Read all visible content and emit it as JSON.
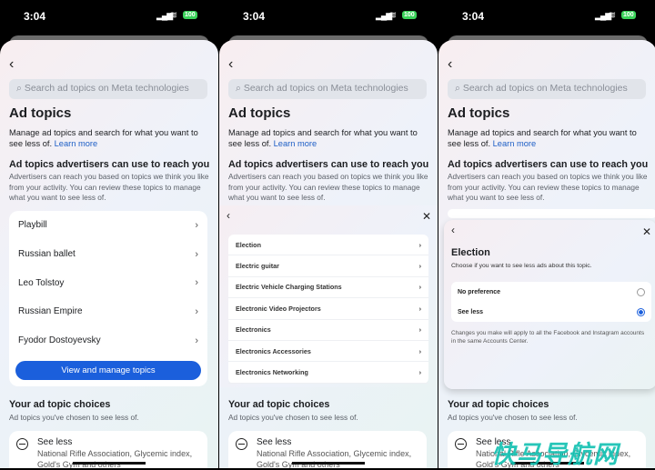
{
  "status": {
    "time": "3:04",
    "battery": "100"
  },
  "common": {
    "search_placeholder": "Search ad topics on Meta technologies",
    "title": "Ad topics",
    "description": "Manage ad topics and search for what you want to see less of.",
    "learn_more": "Learn more",
    "section_heading": "Ad topics advertisers can use to reach you",
    "section_text": "Advertisers can reach you based on topics we think you like from your activity. You can review these topics to manage what you want to see less of.",
    "choices_heading": "Your ad topic choices",
    "choices_text": "Ad topics you've chosen to see less of.",
    "choice_label": "See less",
    "choice_topics": "National Rifle Association, Glycemic index, Gold's Gym and others"
  },
  "panel1": {
    "topics": [
      "Playbill",
      "Russian ballet",
      "Leo Tolstoy",
      "Russian Empire",
      "Fyodor Dostoyevsky"
    ],
    "button": "View and manage topics"
  },
  "panel2": {
    "topics": [
      "Election",
      "Electric guitar",
      "Electric Vehicle Charging Stations",
      "Electronic Video Projectors",
      "Electronics",
      "Electronics Accessories",
      "Electronics Networking"
    ]
  },
  "panel3": {
    "title": "Election",
    "subtitle": "Choose if you want to see less ads about this topic.",
    "options": [
      {
        "label": "No preference",
        "selected": false
      },
      {
        "label": "See less",
        "selected": true
      }
    ],
    "note": "Changes you make will apply to all the Facebook and Instagram accounts in the same Accounts Center."
  },
  "watermark": "快马导航网",
  "colors": {
    "accent": "#1b5fdc",
    "battery": "#3bd35a"
  }
}
